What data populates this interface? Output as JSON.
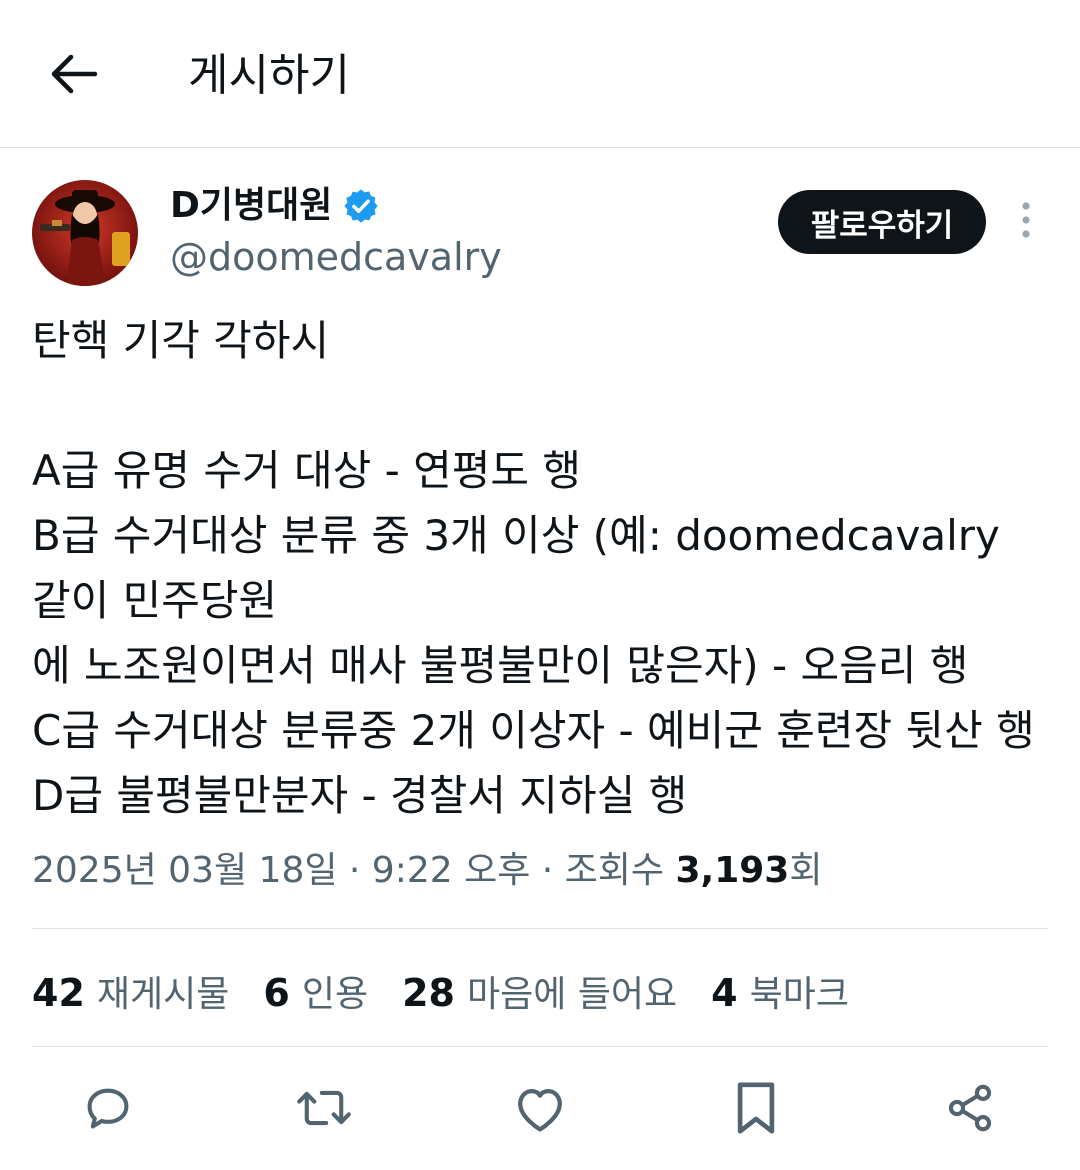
{
  "header": {
    "back_icon": "arrow-left-icon",
    "title": "게시하기"
  },
  "author": {
    "avatar_icon": "avatar-image",
    "display_name": "D기병대원",
    "verified_icon": "verified-badge-icon",
    "handle": "@doomedcavalry"
  },
  "follow_button": {
    "label": "팔로우하기"
  },
  "more_icon": "more-vertical-icon",
  "post": {
    "lines": [
      "탄핵 기각 각하시",
      "",
      "A급 유명 수거 대상 - 연평도 행",
      "B급 수거대상 분류 중 3개 이상 (예: doomedcavalry",
      "같이 민주당원",
      "에 노조원이면서 매사 불평불만이 많은자) - 오음리 행",
      "C급 수거대상 분류중 2개 이상자 - 예비군 훈련장 뒷산 행",
      "D급 불평불만분자 - 경찰서 지하실 행"
    ]
  },
  "meta": {
    "timestamp": "2025년 03월 18일 · 9:22 오후 · 조회수 ",
    "views_count": "3,193",
    "views_suffix": "회"
  },
  "stats": [
    {
      "count": "42",
      "label": "재게시물"
    },
    {
      "count": "6",
      "label": "인용"
    },
    {
      "count": "28",
      "label": "마음에 들어요"
    },
    {
      "count": "4",
      "label": "북마크"
    }
  ],
  "actions": [
    {
      "icon": "reply-icon"
    },
    {
      "icon": "repost-icon"
    },
    {
      "icon": "like-icon"
    },
    {
      "icon": "bookmark-icon"
    },
    {
      "icon": "share-icon"
    }
  ],
  "colors": {
    "text_primary": "#0f1419",
    "text_secondary": "#536471",
    "divider": "#dfe3e6",
    "verified": "#1d9bf0",
    "follow_bg": "#0f1419"
  }
}
